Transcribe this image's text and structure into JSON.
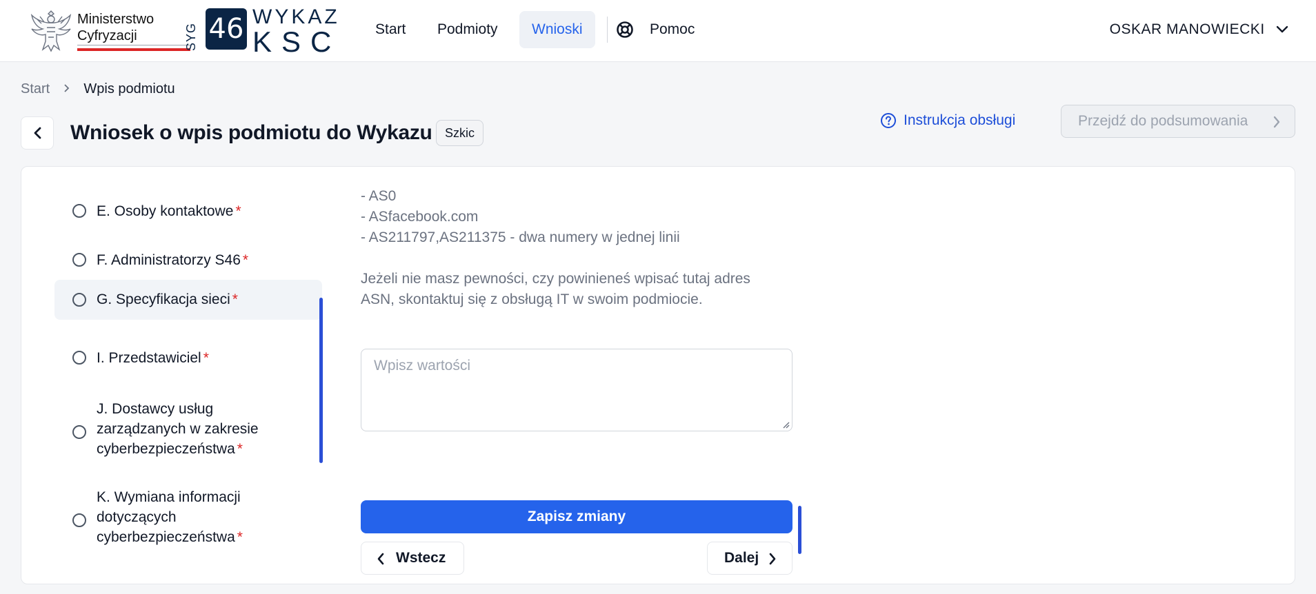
{
  "header": {
    "ministry_line1": "Ministerstwo",
    "ministry_line2": "Cyfryzacji",
    "logo_vertical": "SYG",
    "logo_number": "46",
    "logo_wykaz": "WYKAZ",
    "logo_ksc": "KSC",
    "nav": [
      {
        "label": "Start",
        "active": false
      },
      {
        "label": "Podmioty",
        "active": false
      },
      {
        "label": "Wnioski",
        "active": true
      },
      {
        "label": "Pomoc",
        "active": false,
        "icon": "lifebuoy-icon"
      }
    ],
    "user_name": "OSKAR MANOWIECKI"
  },
  "breadcrumb": {
    "items": [
      "Start",
      "Wpis podmiotu"
    ]
  },
  "page": {
    "title": "Wniosek o wpis podmiotu do Wykazu",
    "status": "Szkic",
    "instructions_label": "Instrukcja obsługi",
    "summary_label": "Przejdź do podsumowania"
  },
  "steps": [
    {
      "label": "E. Osoby kontaktowe",
      "required": true,
      "current": false
    },
    {
      "label": "F. Administratorzy S46",
      "required": true,
      "current": false
    },
    {
      "label": "G. Specyfikacja sieci",
      "required": true,
      "current": true
    },
    {
      "label": "I. Przedstawiciel",
      "required": true,
      "current": false
    },
    {
      "label": "J. Dostawcy usług zarządzanych w zakresie cyberbezpieczeństwa",
      "required": true,
      "current": false
    },
    {
      "label": "K. Wymiana informacji dotyczących cyberbezpieczeństwa",
      "required": true,
      "current": false
    }
  ],
  "form": {
    "examples": [
      "- AS0",
      "- ASfacebook.com",
      "- AS211797,AS211375 - dwa numery w jednej linii"
    ],
    "hint_line1": "Jeżeli nie masz pewności, czy powinieneś wpisać tutaj adres",
    "hint_line2": "ASN, skontaktuj się z obsługą IT w swoim podmiocie.",
    "textarea_placeholder": "Wpisz wartości",
    "textarea_value": "",
    "save_label": "Zapisz zmiany",
    "prev_label": "Wstecz",
    "next_label": "Dalej"
  },
  "colors": {
    "primary": "#2563eb",
    "required": "#dc2626",
    "logo_navy": "#0b2545"
  }
}
